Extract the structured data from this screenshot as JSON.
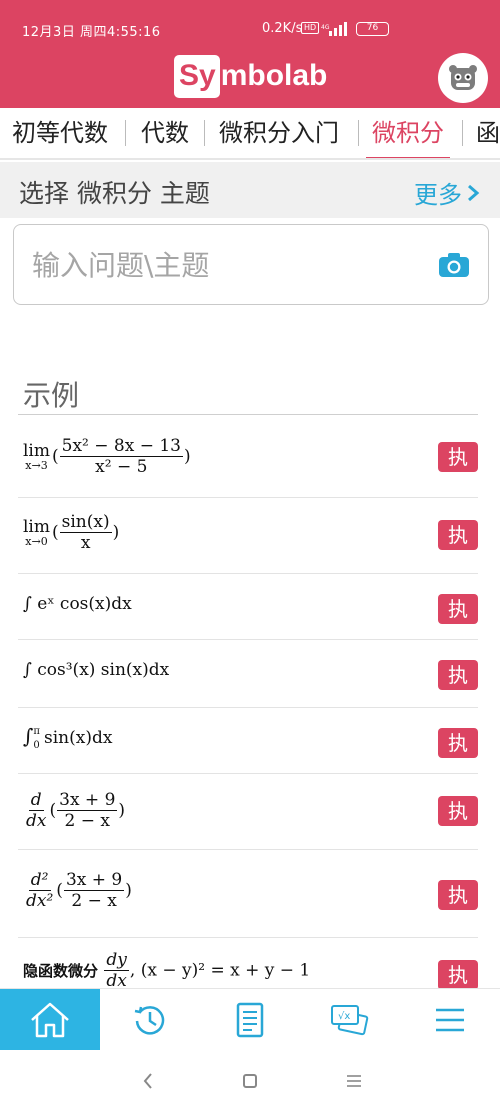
{
  "status_bar": {
    "time": "12月3日 周四4:55:16",
    "net_speed": "0.2K/s",
    "hd": "HD",
    "battery": "76"
  },
  "header": {
    "logo_box": "Sy",
    "logo_rest": "mbolab"
  },
  "tabs": [
    {
      "label": "初等代数"
    },
    {
      "label": "代数"
    },
    {
      "label": "微积分入门"
    },
    {
      "label": "微积分",
      "active": true
    },
    {
      "label": "函"
    }
  ],
  "topic_bar": {
    "title": "选择 微积分 主题",
    "more": "更多"
  },
  "search": {
    "placeholder": "输入问题\\主题"
  },
  "examples": {
    "title": "示例",
    "button_label": "执",
    "items": [
      {
        "prefix": "lim",
        "sub": "x→3",
        "num": "5x² − 8x − 13",
        "den": "x² − 5"
      },
      {
        "prefix": "lim",
        "sub": "x→0",
        "num": "sin(x)",
        "den": "x"
      },
      {
        "text": "∫ eˣ cos(x)dx"
      },
      {
        "text": "∫ cos³(x) sin(x)dx"
      },
      {
        "text": "∫₀^π sin(x)dx",
        "upper": "π",
        "lower": "0",
        "body": "sin(x)dx"
      },
      {
        "dnum": "d",
        "dden": "dx",
        "num": "3x + 9",
        "den": "2 − x"
      },
      {
        "dnum": "d²",
        "dden": "dx²",
        "num": "3x + 9",
        "den": "2 − x"
      },
      {
        "label": "隐函数微分",
        "dnum": "dy",
        "dden": "dx",
        "tail": ", (x − y)² = x + y − 1"
      }
    ]
  },
  "bottom_nav": [
    "home-icon",
    "history-icon",
    "notebook-icon",
    "practice-icon",
    "menu-icon"
  ],
  "colors": {
    "brand": "#dc4462",
    "accent": "#2db4e3",
    "link": "#29a7d6"
  }
}
